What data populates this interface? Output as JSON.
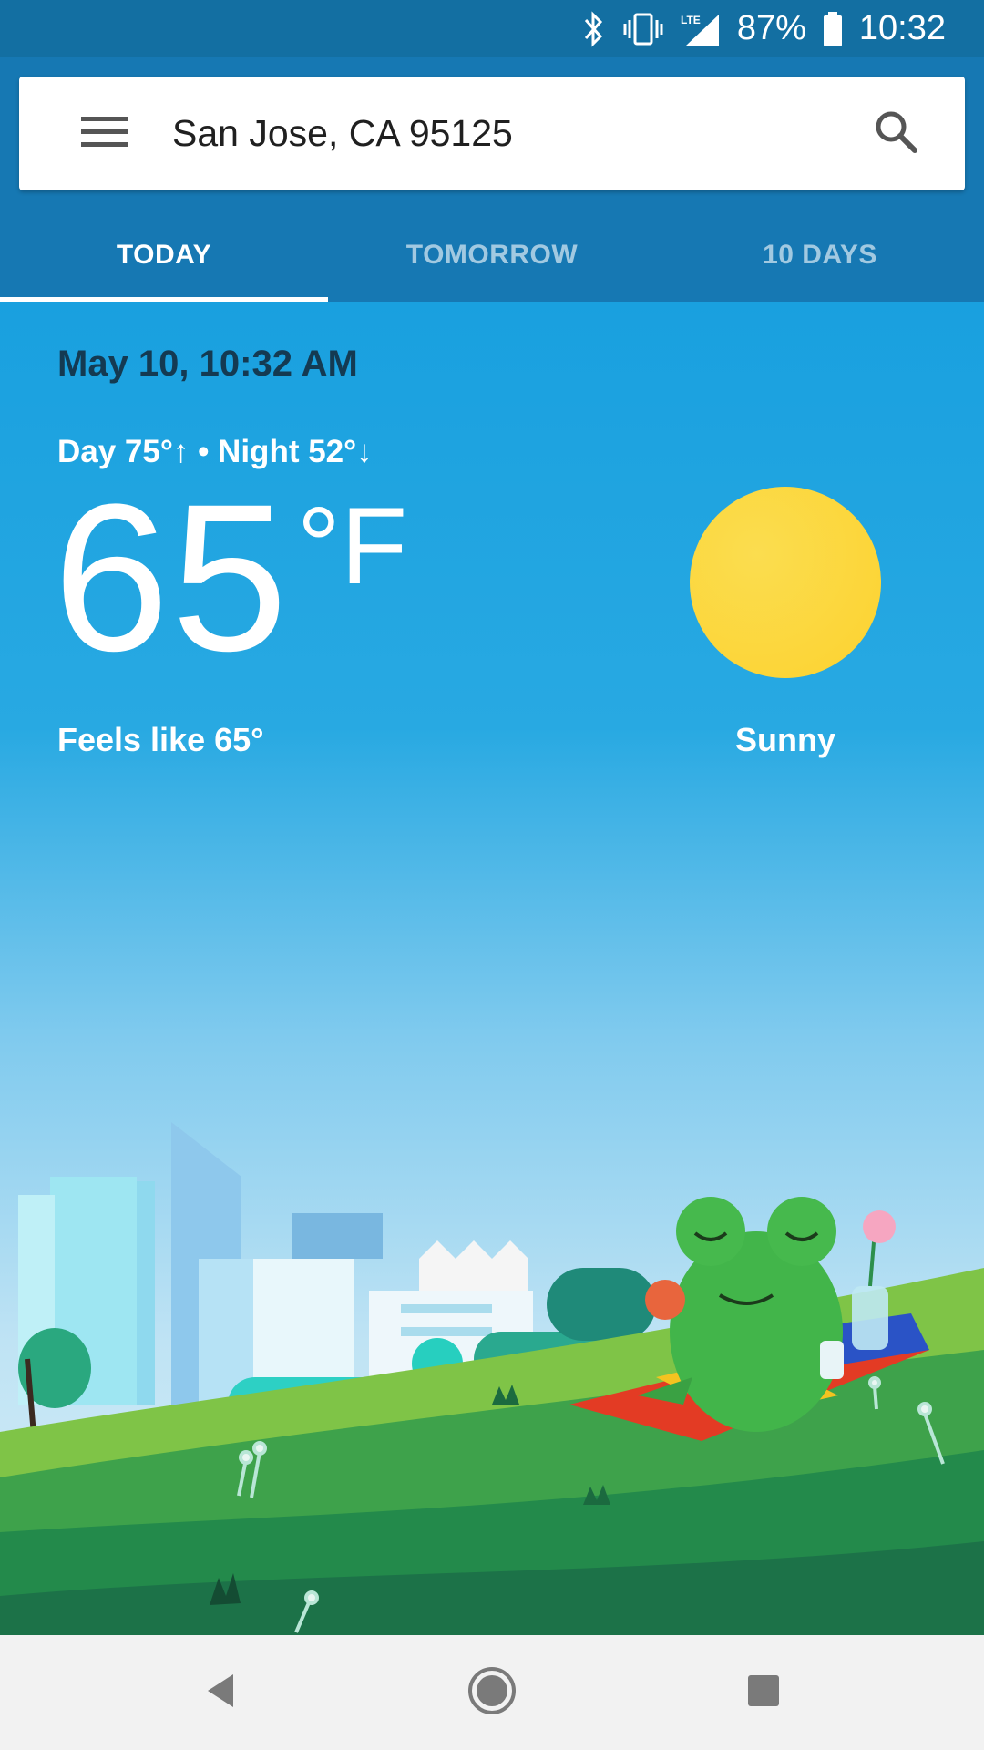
{
  "status_bar": {
    "battery": "87%",
    "time": "10:32",
    "network": "LTE"
  },
  "search": {
    "location": "San Jose, CA 95125"
  },
  "tabs": [
    {
      "label": "TODAY",
      "active": true
    },
    {
      "label": "TOMORROW",
      "active": false
    },
    {
      "label": "10 DAYS",
      "active": false
    }
  ],
  "weather": {
    "datetime": "May 10, 10:32 AM",
    "day_night": "Day 75°↑ • Night 52°↓",
    "temperature": "65",
    "unit": "°F",
    "feels_like": "Feels like 65°",
    "condition": "Sunny"
  },
  "icons": {
    "menu": "menu-icon",
    "search": "search-icon",
    "sun": "sun-icon",
    "back": "back-icon",
    "home": "home-icon",
    "recents": "recents-icon"
  },
  "colors": {
    "status_bar": "#136fa2",
    "app_bar": "#1678b3",
    "sky_top": "#19a0df",
    "sun": "#fcd22f"
  }
}
